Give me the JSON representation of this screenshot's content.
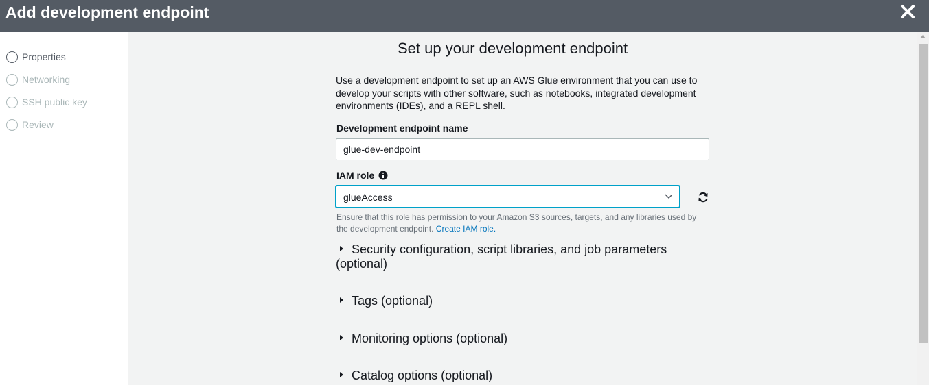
{
  "header": {
    "title": "Add development endpoint",
    "close_icon": "close-icon"
  },
  "sidebar": {
    "steps": [
      {
        "label": "Properties",
        "state": "active"
      },
      {
        "label": "Networking",
        "state": "disabled"
      },
      {
        "label": "SSH public key",
        "state": "disabled"
      },
      {
        "label": "Review",
        "state": "disabled"
      }
    ]
  },
  "main": {
    "title": "Set up your development endpoint",
    "intro": "Use a development endpoint to set up an AWS Glue environment that you can use to develop your scripts with other software, such as notebooks, integrated development environments (IDEs), and a REPL shell.",
    "endpoint_name": {
      "label": "Development endpoint name",
      "value": "glue-dev-endpoint"
    },
    "iam_role": {
      "label": "IAM role",
      "value": "glueAccess",
      "hint": "Ensure that this role has permission to your Amazon S3 sources, targets, and any libraries used by the development endpoint.",
      "link": "Create IAM role."
    },
    "sections": [
      {
        "label": "Security configuration, script libraries, and job parameters (optional)"
      },
      {
        "label": "Tags (optional)"
      },
      {
        "label": "Monitoring options (optional)"
      },
      {
        "label": "Catalog options (optional)"
      }
    ]
  },
  "colors": {
    "header_bg": "#545b64",
    "accent": "#00a1c9",
    "link": "#0073bb",
    "disabled_text": "#aab7b8"
  }
}
